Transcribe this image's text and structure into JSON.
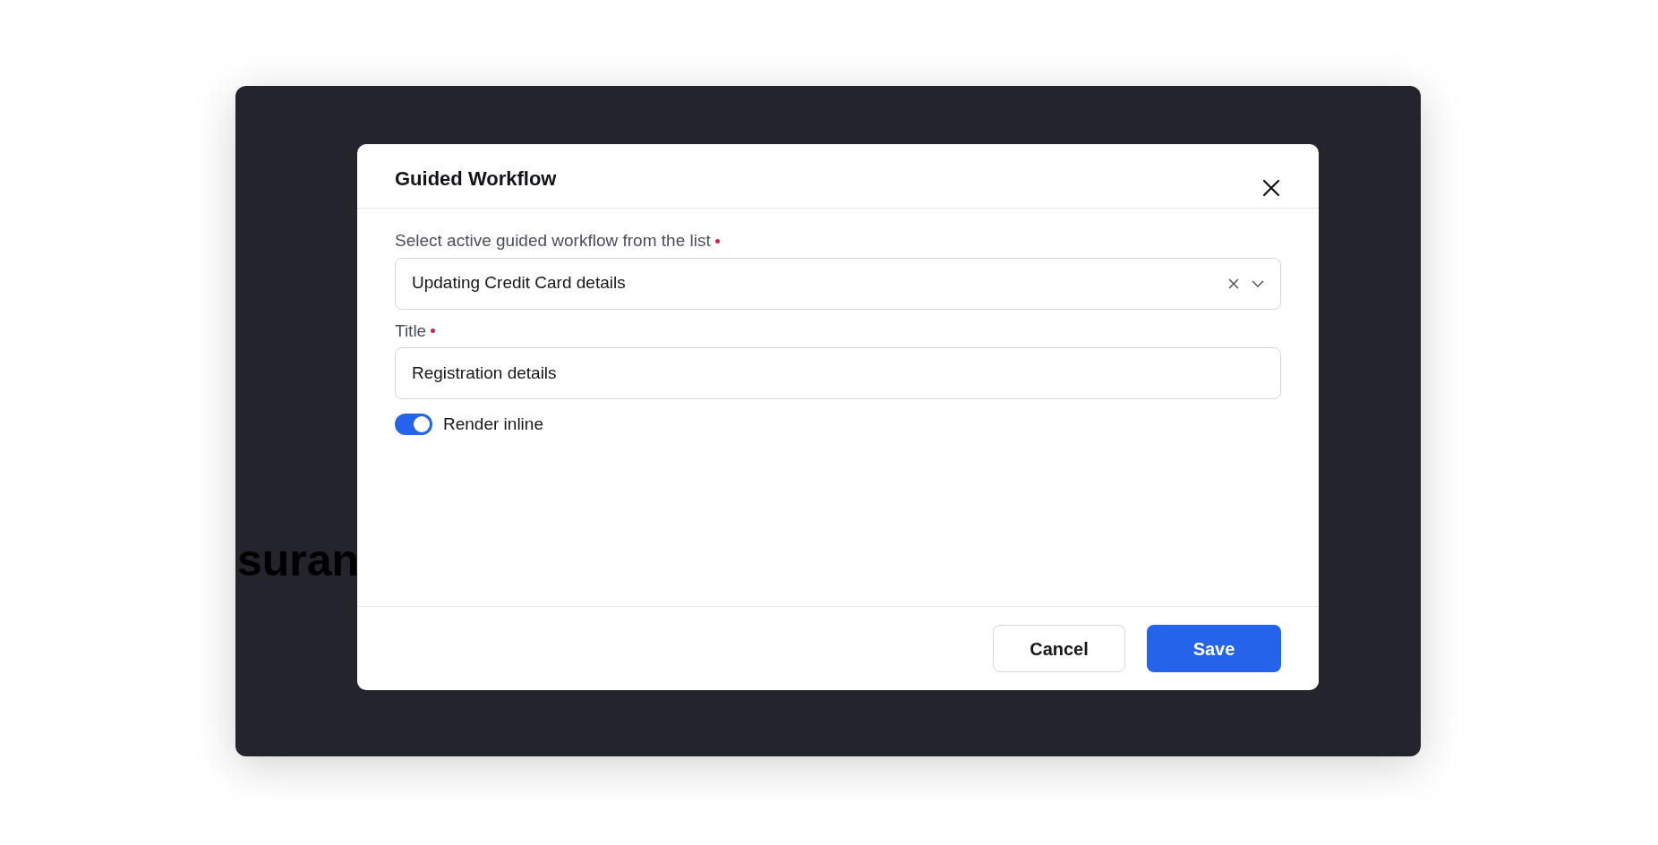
{
  "background": {
    "heading_fragment": "suran"
  },
  "dialog": {
    "title": "Guided Workflow",
    "fields": [
      {
        "kind": "select",
        "label": "Select active guided workflow from the list",
        "required": true,
        "value": "Updating Credit Card details"
      },
      {
        "kind": "text",
        "label": "Title",
        "required": true,
        "value": "Registration details"
      }
    ],
    "toggle": {
      "label": "Render inline",
      "on": true
    },
    "buttons": [
      {
        "label": "Cancel",
        "kind": "secondary"
      },
      {
        "label": "Save",
        "kind": "primary"
      }
    ]
  }
}
